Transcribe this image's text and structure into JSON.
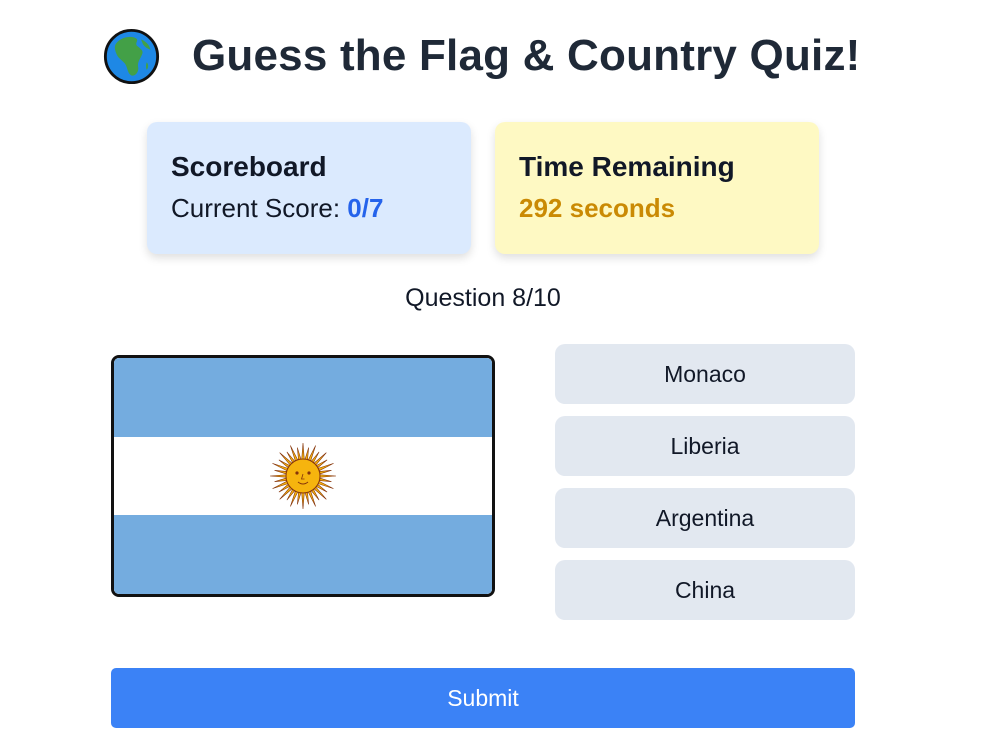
{
  "header": {
    "icon": "globe-africa-icon",
    "title": "Guess the Flag & Country Quiz!"
  },
  "scoreboard": {
    "title": "Scoreboard",
    "label": "Current Score: ",
    "value": "0/7"
  },
  "timer": {
    "title": "Time Remaining",
    "value": "292 seconds"
  },
  "question": {
    "counter": "Question 8/10",
    "flag_icon": "argentina-flag"
  },
  "options": [
    {
      "label": "Monaco"
    },
    {
      "label": "Liberia"
    },
    {
      "label": "Argentina"
    },
    {
      "label": "China"
    }
  ],
  "submit_label": "Submit",
  "colors": {
    "score_accent": "#2563eb",
    "time_accent": "#ca8a04",
    "submit_bg": "#3b82f6",
    "option_bg": "#e2e8f0",
    "scoreboard_bg": "#dbeafe",
    "timer_bg": "#fef9c3",
    "flag_blue": "#74acdf",
    "flag_sun": "#f6b40e"
  }
}
